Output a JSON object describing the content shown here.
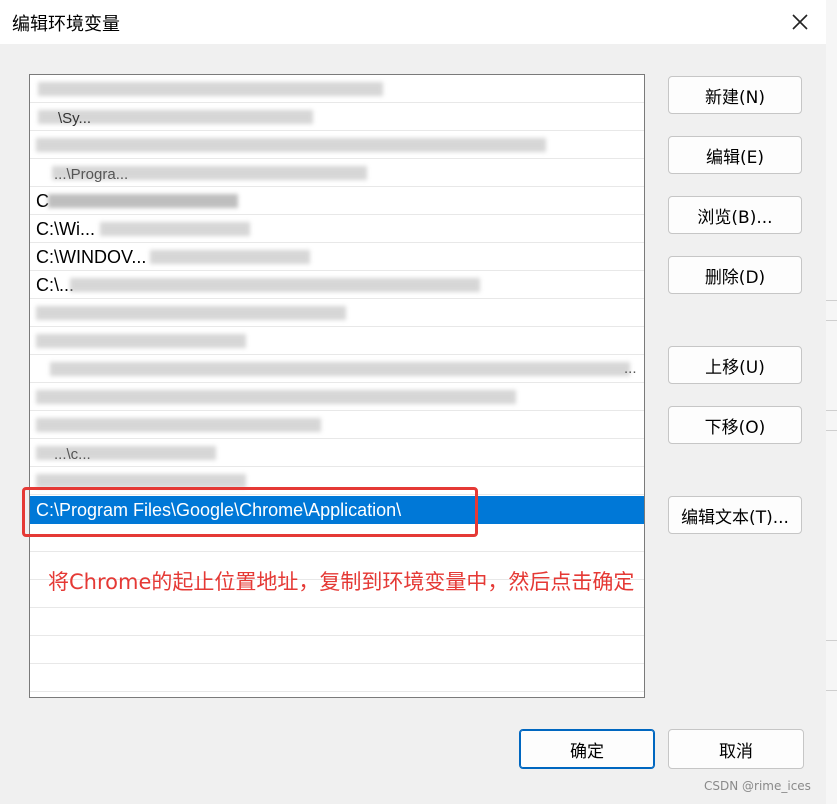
{
  "window": {
    "title": "编辑环境变量",
    "close_icon": "close-icon"
  },
  "path_list": {
    "visible_fragments": [
      "\\Sy...",
      "...\\Progra...",
      "C",
      "C:\\Wi...",
      "C:\\WINDOV...",
      "C:\\...",
      "...\\c...",
      "..."
    ],
    "selected_entry": "C:\\Program Files\\Google\\Chrome\\Application\\"
  },
  "buttons": {
    "new": "新建(N)",
    "edit": "编辑(E)",
    "browse": "浏览(B)...",
    "delete": "删除(D)",
    "move_up": "上移(U)",
    "move_down": "下移(O)",
    "edit_text": "编辑文本(T)...",
    "ok": "确定",
    "cancel": "取消"
  },
  "annotation": {
    "text": "将Chrome的起止位置地址，复制到环境变量中，然后点击确定",
    "color": "#e53935"
  },
  "colors": {
    "selection": "#0078d7",
    "primary_border": "#0067c0"
  },
  "watermark": "CSDN @rime_ices"
}
